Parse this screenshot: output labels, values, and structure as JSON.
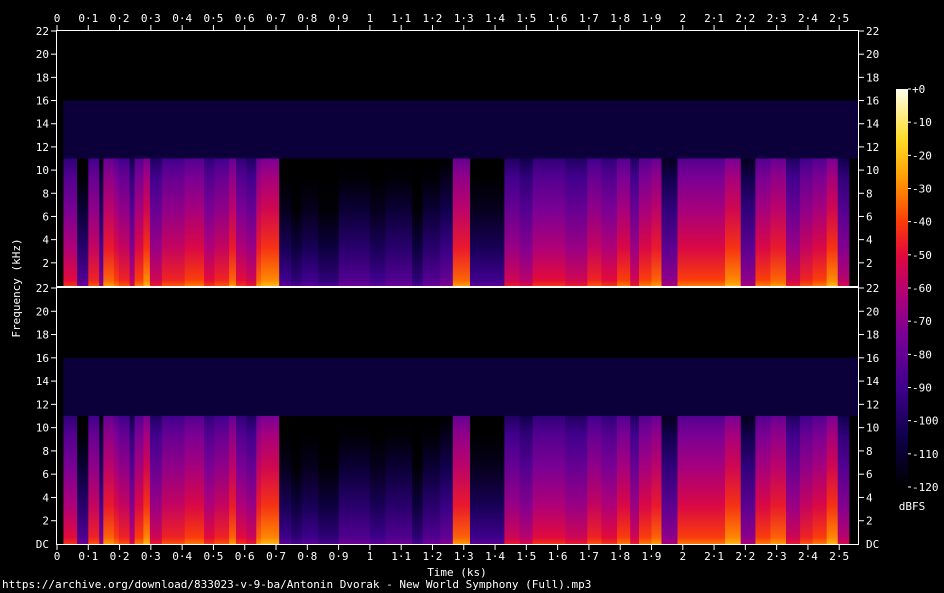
{
  "source_url": "https://archive.org/download/833023-v-9-ba/Antonin Dvorak - New World Symphony (Full).mp3",
  "chart_data": {
    "type": "heatmap",
    "xlabel": "Time (ks)",
    "ylabel": "Frequency (kHz)",
    "xlim": [
      0,
      2.56
    ],
    "ylim": [
      0,
      22
    ],
    "x_ticks": [
      "0",
      "0·1",
      "0·2",
      "0·3",
      "0·4",
      "0·5",
      "0·6",
      "0·7",
      "0·8",
      "0·9",
      "1",
      "1·1",
      "1·2",
      "1·3",
      "1·4",
      "1·5",
      "1·6",
      "1·7",
      "1·8",
      "1·9",
      "2",
      "2·1",
      "2·2",
      "2·3",
      "2·4",
      "2·5"
    ],
    "y_ticks_channel": [
      "2",
      "4",
      "6",
      "8",
      "10",
      "12",
      "14",
      "16",
      "18",
      "20",
      "22"
    ],
    "y_bottom_label": "DC",
    "colorbar": {
      "label": "dBFS",
      "ticks": [
        "+0",
        "-10",
        "-20",
        "-30",
        "-40",
        "-50",
        "-60",
        "-70",
        "-80",
        "-90",
        "-100",
        "-110",
        "-120"
      ],
      "range": [
        -120,
        0
      ]
    },
    "channels": 2,
    "cutoff_khz": 11,
    "band_edges_ks": [
      0.02,
      0.064,
      0.1,
      0.135,
      0.148,
      0.182,
      0.197,
      0.232,
      0.248,
      0.276,
      0.297,
      0.335,
      0.378,
      0.408,
      0.445,
      0.47,
      0.503,
      0.55,
      0.572,
      0.605,
      0.637,
      0.652,
      0.667,
      0.71,
      0.748,
      0.782,
      0.835,
      0.9,
      0.945,
      1.0,
      1.05,
      1.135,
      1.168,
      1.225,
      1.265,
      1.32,
      1.375,
      1.43,
      1.478,
      1.52,
      1.575,
      1.625,
      1.695,
      1.74,
      1.79,
      1.832,
      1.86,
      1.9,
      1.932,
      1.983,
      2.06,
      2.1,
      2.135,
      2.185,
      2.232,
      2.28,
      2.33,
      2.375,
      2.415,
      2.46,
      2.495,
      2.53
    ],
    "band_peaks_dbfs": [
      -50,
      -85,
      -45,
      -75,
      -35,
      -40,
      -45,
      -60,
      -40,
      -30,
      -55,
      -45,
      -45,
      -40,
      -40,
      -50,
      -45,
      -35,
      -50,
      -55,
      -35,
      -30,
      -30,
      -90,
      -95,
      -90,
      -95,
      -85,
      -85,
      -90,
      -85,
      -95,
      -85,
      -80,
      -35,
      -90,
      -90,
      -55,
      -60,
      -50,
      -50,
      -55,
      -45,
      -50,
      -40,
      -55,
      -40,
      -35,
      -70,
      -40,
      -40,
      -40,
      -30,
      -70,
      -40,
      -35,
      -55,
      -45,
      -40,
      -30,
      -60
    ]
  }
}
